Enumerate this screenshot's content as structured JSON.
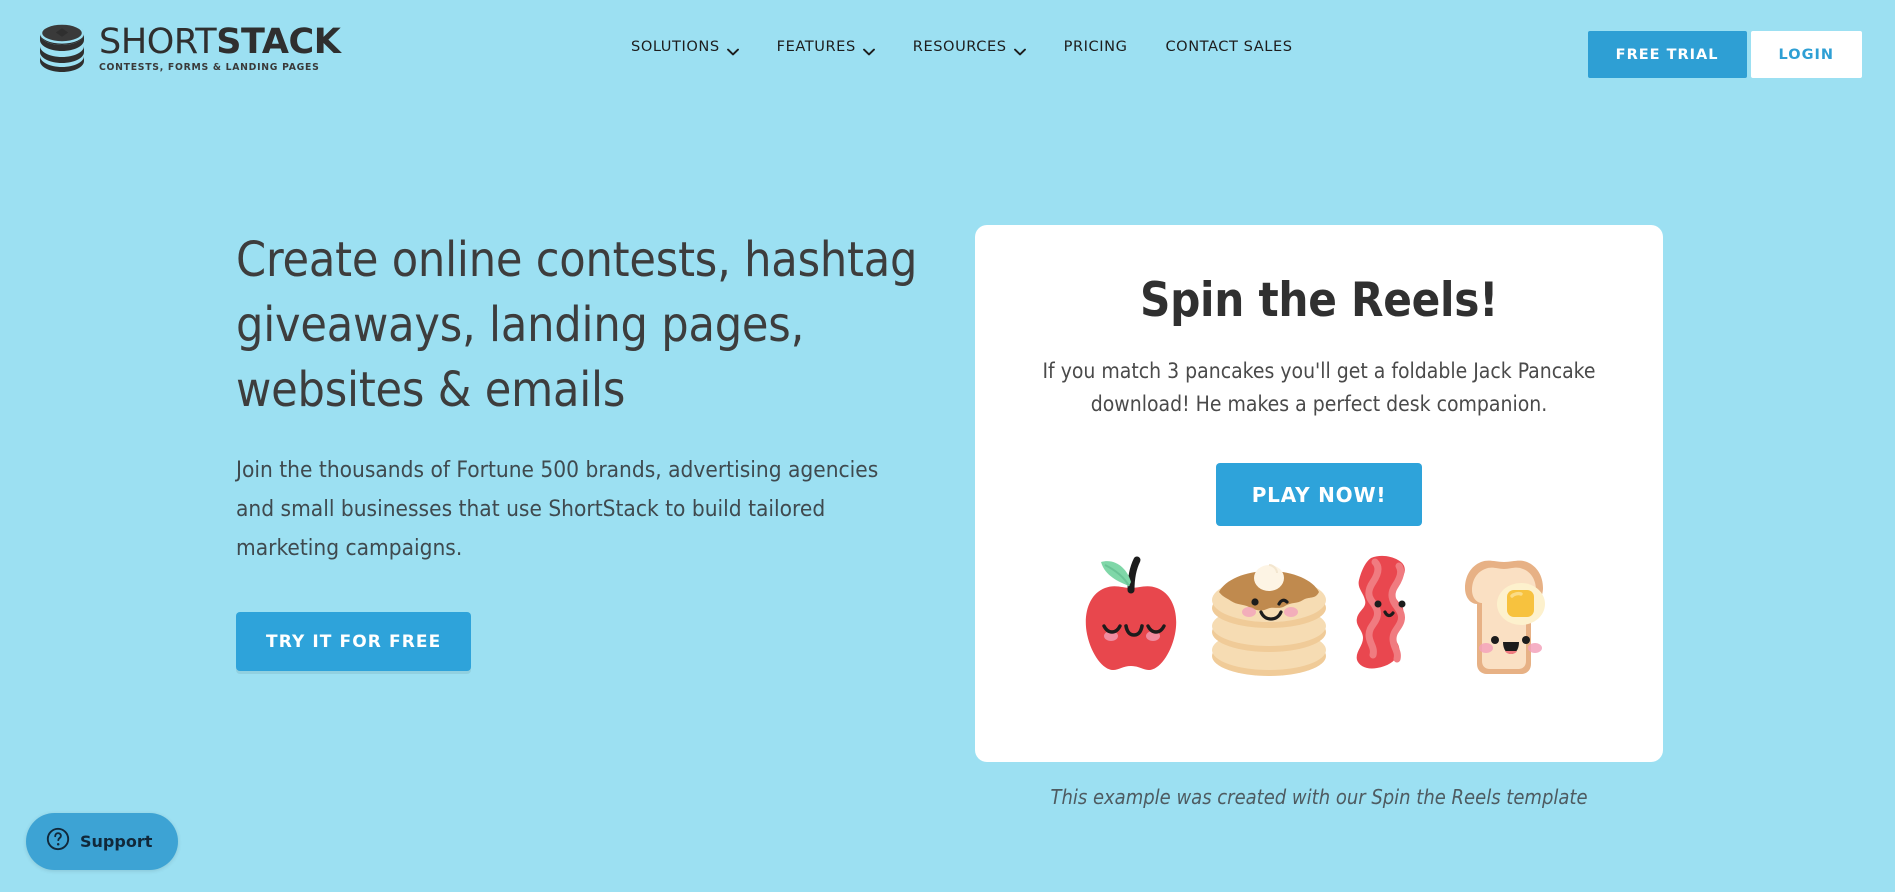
{
  "theme": {
    "page_background": "#9ce0f2",
    "accent_blue": "#2ea3da",
    "header_button_blue": "#2e9fd4",
    "support_blue": "#3da3d4",
    "card_background": "#ffffff",
    "heading_text": "#3d3d3d"
  },
  "header": {
    "logo": {
      "word_light": "SHORT",
      "word_bold": "STACK",
      "tagline": "CONTESTS, FORMS & LANDING PAGES",
      "icon": "stacked-discs-icon"
    },
    "nav": [
      {
        "label": "SOLUTIONS",
        "has_dropdown": true
      },
      {
        "label": "FEATURES",
        "has_dropdown": true
      },
      {
        "label": "RESOURCES",
        "has_dropdown": true
      },
      {
        "label": "PRICING",
        "has_dropdown": false
      },
      {
        "label": "CONTACT SALES",
        "has_dropdown": false
      }
    ],
    "free_trial_label": "FREE TRIAL",
    "login_label": "LOGIN"
  },
  "hero": {
    "headline": "Create online contests, hashtag giveaways, landing pages, websites & emails",
    "subheadline": "Join the thousands of Fortune 500 brands, advertising agencies and small businesses that use ShortStack to build tailored marketing campaigns.",
    "cta_label": "TRY IT FOR FREE"
  },
  "promo_card": {
    "title": "Spin the Reels!",
    "description": "If you match 3 pancakes you'll get a foldable Jack Pancake download! He makes a perfect desk companion.",
    "play_label": "PLAY NOW!",
    "food_icons": [
      "apple-icon",
      "pancake-stack-icon",
      "bacon-icon",
      "buttered-toast-icon"
    ],
    "caption": "This example was created with our Spin the Reels template"
  },
  "support": {
    "label": "Support",
    "icon": "question-mark-circle-icon"
  }
}
